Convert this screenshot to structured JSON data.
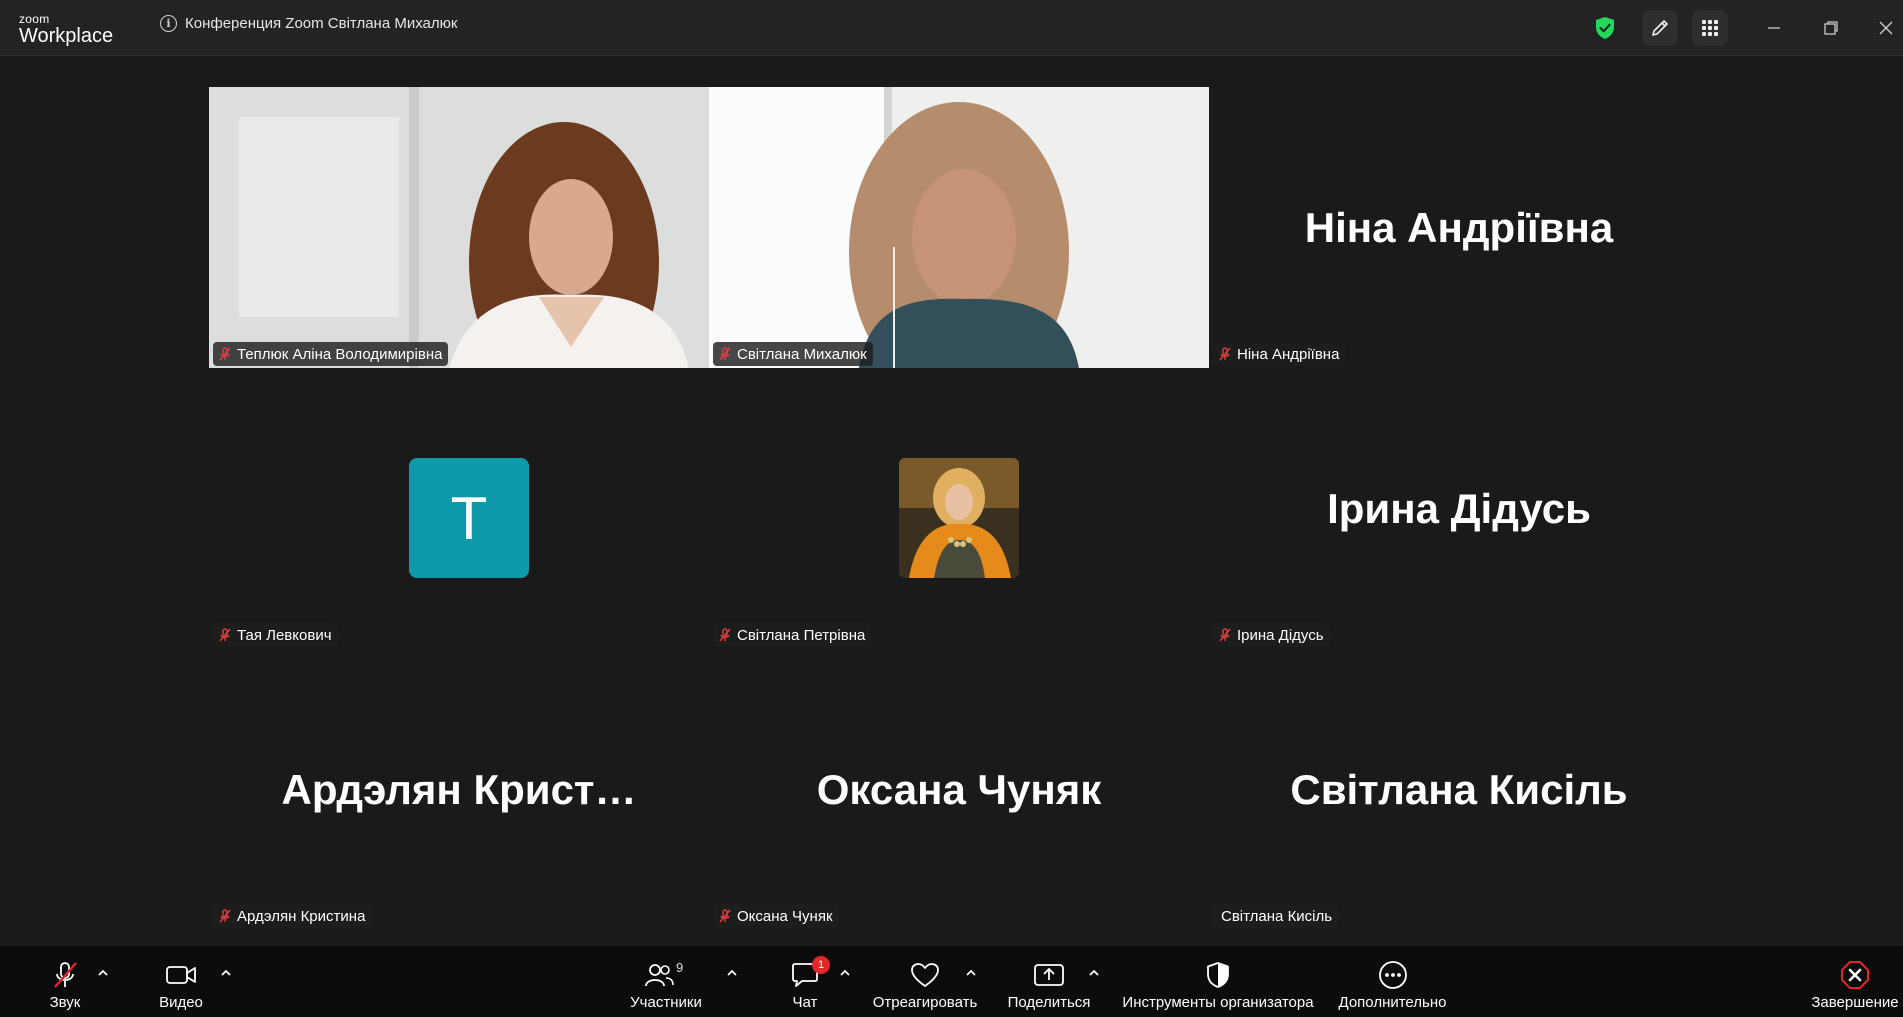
{
  "app": {
    "logo_top": "zoom",
    "logo_bottom": "Workplace"
  },
  "meeting": {
    "title": "Конференция Zoom Світлана Михалюк"
  },
  "colors": {
    "accent_green": "#23d959",
    "muted_red": "#e0403f",
    "avatar_teal": "#0e9aa8",
    "badge_red": "#e02828"
  },
  "participants": [
    {
      "name": "Теплюк Аліна Володимирівна",
      "display": "video",
      "muted": true
    },
    {
      "name": "Світлана Михалюк",
      "display": "video",
      "muted": true,
      "active_speaker": true
    },
    {
      "name": "Ніна Андріївна",
      "display": "name",
      "big_name": "Ніна Андріївна",
      "muted": true
    },
    {
      "name": "Тая Левкович",
      "display": "avatar-letter",
      "initial": "T",
      "muted": true
    },
    {
      "name": "Світлана Петрівна",
      "display": "avatar-photo",
      "muted": true
    },
    {
      "name": "Ірина Дідусь",
      "display": "name",
      "big_name": "Ірина Дідусь",
      "muted": true
    },
    {
      "name": "Ардэлян Кристина",
      "display": "name",
      "big_name": "Ардэлян  Крист…",
      "muted": true
    },
    {
      "name": "Оксана Чуняк",
      "display": "name",
      "big_name": "Оксана Чуняк",
      "muted": true
    },
    {
      "name": "Світлана Кисіль",
      "display": "name",
      "big_name": "Світлана Кисіль",
      "muted": false
    }
  ],
  "toolbar": {
    "audio": {
      "label": "Звук",
      "icon": "mic-muted-icon"
    },
    "video": {
      "label": "Видео",
      "icon": "camera-icon"
    },
    "participants": {
      "label": "Участники",
      "count": "9",
      "icon": "people-icon"
    },
    "chat": {
      "label": "Чат",
      "badge": "1",
      "icon": "chat-icon"
    },
    "react": {
      "label": "Отреагировать",
      "icon": "heart-icon"
    },
    "share": {
      "label": "Поделиться",
      "icon": "share-screen-icon"
    },
    "host_tools": {
      "label": "Инструменты организатора",
      "icon": "shield-icon"
    },
    "more": {
      "label": "Дополнительно",
      "icon": "more-icon"
    },
    "end": {
      "label": "Завершение",
      "icon": "end-icon"
    }
  }
}
